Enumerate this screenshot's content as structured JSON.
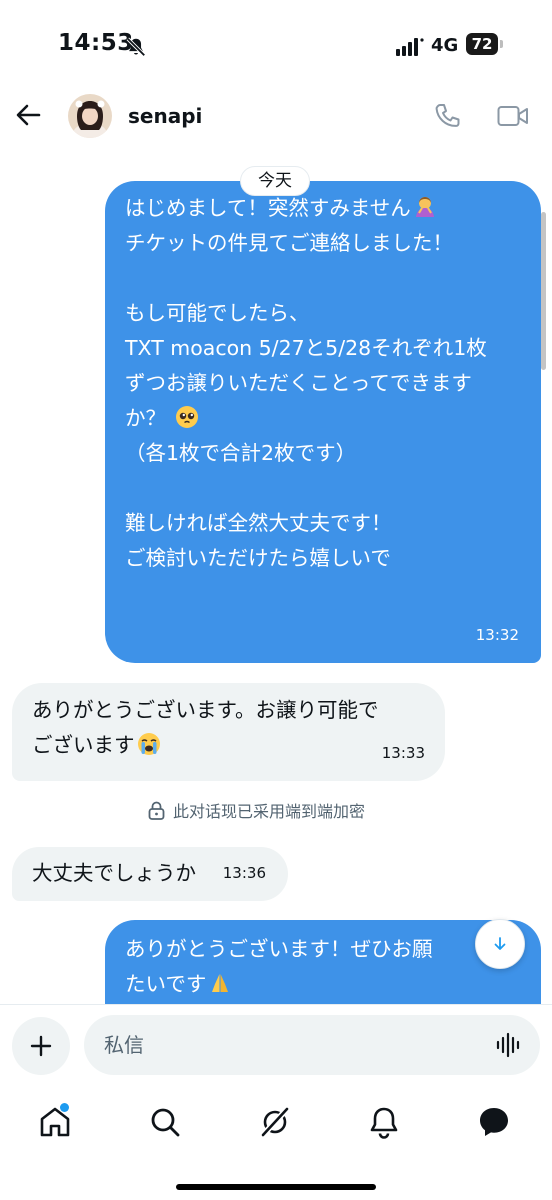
{
  "status_bar": {
    "time": "14:53",
    "network": "4G",
    "battery": "72"
  },
  "header": {
    "contact_name": "senapi"
  },
  "chat": {
    "date_chip": "今天",
    "messages": [
      {
        "dir": "out",
        "lines": [
          "はじめまして！突然すみません",
          "チケットの件見てご連絡しました！",
          "",
          "もし可能でしたら、",
          "TXT  moacon 5/27と5/28それぞれ1枚",
          "ずつお譲りいただくことってできます",
          "か？ ",
          "（各1枚で合計2枚です）",
          "",
          "難しければ全然大丈夫です！",
          "ご検討いただけたら嬉しいで"
        ],
        "time": "13:32"
      },
      {
        "dir": "in",
        "lines": [
          "ありがとうございます。お譲り可能で",
          "ございます"
        ],
        "time": "13:33"
      },
      {
        "dir": "in",
        "lines": [
          "大丈夫でしょうか"
        ],
        "time": "13:36"
      },
      {
        "dir": "out",
        "lines": [
          "ありがとうございます！ぜひお願",
          "たいです"
        ],
        "time": ""
      }
    ],
    "encryption_notice": "此对话现已采用端到端加密"
  },
  "composer": {
    "placeholder": "私信"
  },
  "colors": {
    "outgoing_bubble": "#3e92e8",
    "incoming_bubble": "#eff3f4",
    "accent": "#1d9bf0"
  },
  "icons": {
    "header": [
      "back-arrow-icon",
      "phone-icon",
      "video-camera-icon"
    ],
    "tabbar": [
      "home-icon",
      "search-icon",
      "grok-icon",
      "bell-icon",
      "messages-icon"
    ]
  }
}
